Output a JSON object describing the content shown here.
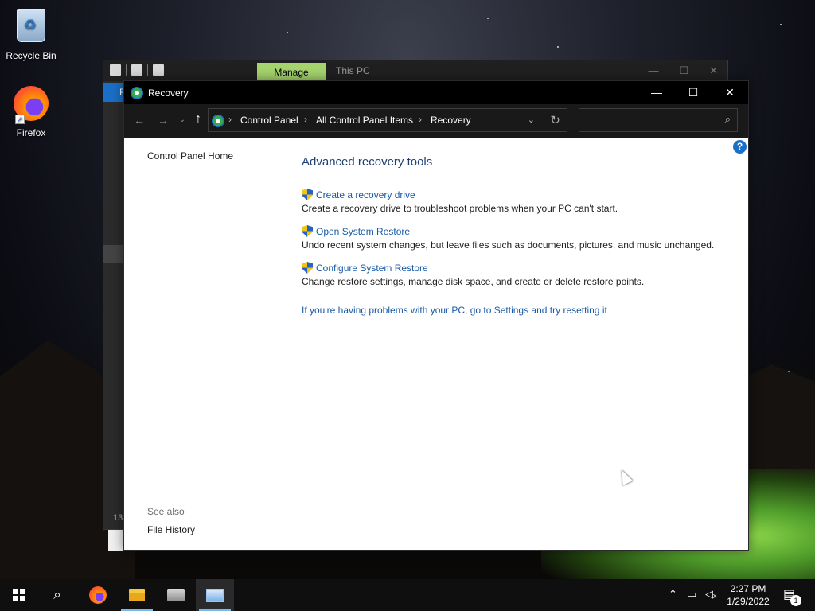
{
  "desktop": {
    "icons": [
      {
        "label": "Recycle Bin",
        "icon": "recycle-bin-icon"
      },
      {
        "label": "Firefox",
        "icon": "firefox-icon"
      }
    ]
  },
  "background_window": {
    "ribbon_tab": "Manage",
    "title": "This PC",
    "file_tab": "F",
    "status_text": "13"
  },
  "window": {
    "title": "Recovery",
    "controls": {
      "minimize": "—",
      "maximize": "☐",
      "close": "✕"
    },
    "address": {
      "breadcrumbs": [
        "Control Panel",
        "All Control Panel Items",
        "Recovery"
      ],
      "separator": "›"
    },
    "search": {
      "placeholder": ""
    },
    "left_pane": {
      "home_link": "Control Panel Home",
      "see_also_label": "See also",
      "see_also_links": [
        "File History"
      ]
    },
    "main": {
      "heading": "Advanced recovery tools",
      "tasks": [
        {
          "link": "Create a recovery drive",
          "description": "Create a recovery drive to troubleshoot problems when your PC can't start."
        },
        {
          "link": "Open System Restore",
          "description": "Undo recent system changes, but leave files such as documents, pictures, and music unchanged."
        },
        {
          "link": "Configure System Restore",
          "description": "Change restore settings, manage disk space, and create or delete restore points."
        }
      ],
      "reset_link": "If you're having problems with your PC, go to Settings and try resetting it"
    }
  },
  "taskbar": {
    "items": [
      "start",
      "search",
      "firefox",
      "file-explorer",
      "server-manager",
      "control-panel"
    ],
    "active_item": "control-panel",
    "clock": {
      "time": "2:27 PM",
      "date": "1/29/2022"
    },
    "notification_count": "1"
  },
  "colors": {
    "link": "#1a5aa6",
    "heading": "#1e3f73",
    "manage_tab": "#a6d46e",
    "titlebar": "#000000",
    "taskbar": "#0f0f10"
  }
}
